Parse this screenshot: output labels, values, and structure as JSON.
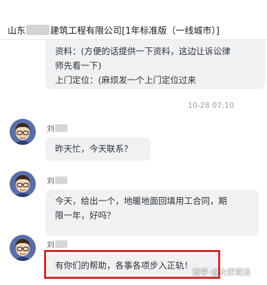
{
  "header": {
    "title_prefix": "山东",
    "title_suffix": "建筑工程有限公司[1年标准版（一线城市）]"
  },
  "messages": {
    "top_line1": "资料：(方便的话提供一下资料，这边让诉讼律",
    "top_line2": "师先看一下)",
    "top_line3": "上门定位：(麻烦发一个上门定位过来",
    "timestamp": "10-28 07:10",
    "sender_name": "刘",
    "msg1": "昨天忙，今天联系？",
    "msg2_line1": "今天，给出一个，地暖地面回填用工合同，期",
    "msg2_line2": "限一年，好吗？",
    "msg3": "有你们的帮助，各事各项步入正轨！"
  },
  "watermark": "知乎 @大伏说法",
  "colors": {
    "bubble": "#eff1f3",
    "highlight_border": "#d42a2a",
    "timestamp": "#9aa0a6"
  },
  "icons": {
    "avatar": "cartoon-man-with-glasses-avatar"
  }
}
